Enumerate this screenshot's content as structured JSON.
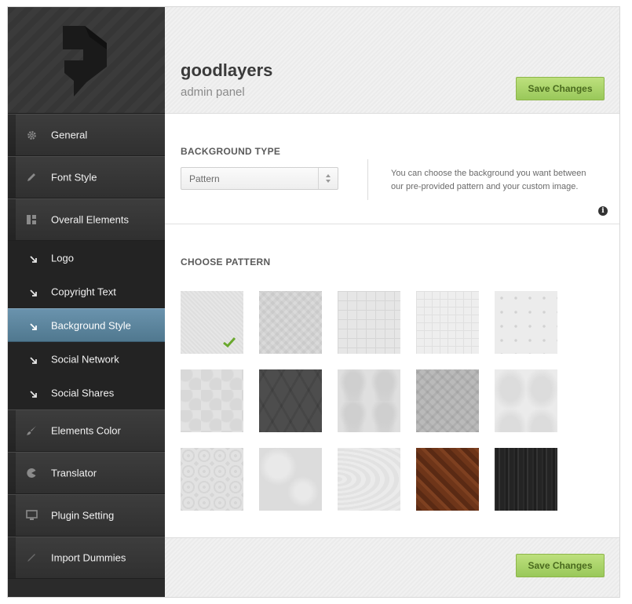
{
  "brand": {
    "name": "goodlayers",
    "subtitle": "admin panel"
  },
  "header": {
    "save_label": "Save Changes"
  },
  "footer": {
    "save_label": "Save Changes"
  },
  "sidebar": {
    "items": [
      {
        "label": "General",
        "icon": "gear-icon"
      },
      {
        "label": "Font Style",
        "icon": "pencil-icon"
      },
      {
        "label": "Overall Elements",
        "icon": "layout-icon"
      },
      {
        "label": "Elements Color",
        "icon": "brush-icon"
      },
      {
        "label": "Translator",
        "icon": "pacman-icon"
      },
      {
        "label": "Plugin Setting",
        "icon": "monitor-icon"
      },
      {
        "label": "Import Dummies",
        "icon": "pen-icon"
      }
    ],
    "subitems": [
      {
        "label": "Logo"
      },
      {
        "label": "Copyright Text"
      },
      {
        "label": "Background Style",
        "active": true
      },
      {
        "label": "Social Network"
      },
      {
        "label": "Social Shares"
      }
    ]
  },
  "background_type": {
    "title": "BACKGROUND TYPE",
    "selected": "Pattern",
    "description": "You can choose the background you want between our pre-provided pattern and your custom image."
  },
  "choose_pattern": {
    "title": "CHOOSE PATTERN",
    "selected_index": 0,
    "pattern_count": 15
  },
  "colors": {
    "accent_green": "#a8d368",
    "active_blue": "#5e879f",
    "sidebar_dark": "#2b2b2b"
  }
}
